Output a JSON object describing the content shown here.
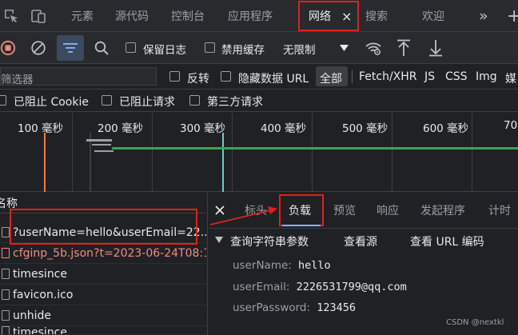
{
  "tabbar": {
    "tabs": [
      "元素",
      "源代码",
      "控制台",
      "应用程序",
      "网络",
      "搜索",
      "欢迎"
    ],
    "active": "网络",
    "close_glyph": "×",
    "more_glyph": "»",
    "add_glyph": "+"
  },
  "toolbar": {
    "preserve_log": "保留日志",
    "disable_cache": "禁用缓存",
    "throttle": "无限制"
  },
  "filter": {
    "placeholder": "筛选器",
    "invert": "反转",
    "hide_data_urls": "隐藏数据 URL",
    "types": [
      "全部",
      "Fetch/XHR",
      "JS",
      "CSS",
      "Img",
      "媒"
    ]
  },
  "blocking": {
    "blocked_cookies": "已阻止 Cookie",
    "blocked_requests": "已阻止请求",
    "third_party": "第三方请求"
  },
  "timeline": {
    "ticks": [
      "100 毫秒",
      "200 毫秒",
      "300 毫秒",
      "400 毫秒",
      "500 毫秒",
      "600 毫秒",
      "70"
    ]
  },
  "requests": {
    "header": "名称",
    "items": [
      {
        "name": "?userName=hello&userEmail=22...",
        "error": false
      },
      {
        "name": "cfginp_5b.json?t=2023-06-24T08:1",
        "error": true
      },
      {
        "name": "timesince",
        "error": false
      },
      {
        "name": "favicon.ico",
        "error": false
      },
      {
        "name": "unhide",
        "error": false
      },
      {
        "name": "timesince",
        "error": false
      }
    ]
  },
  "details": {
    "tabs": [
      "标头",
      "负载",
      "预览",
      "响应",
      "发起程序",
      "计时"
    ],
    "active": "负载",
    "section_title": "查询字符串参数",
    "view_source": "查看源",
    "view_url_encoded": "查看 URL 编码",
    "params": [
      {
        "key": "userName:",
        "value": "hello"
      },
      {
        "key": "userEmail:",
        "value": "2226531799@qq.com"
      },
      {
        "key": "userPassword:",
        "value": "123456"
      }
    ]
  },
  "watermark": "CSDN @nextkl",
  "colors": {
    "background": "#202124",
    "toolbar": "#292a2d",
    "annotation_red": "#e02020",
    "record_red": "#f28b82",
    "error_text": "#f28b82",
    "accent_blue": "#8ab4f8",
    "timeline_green": "#34a853"
  }
}
